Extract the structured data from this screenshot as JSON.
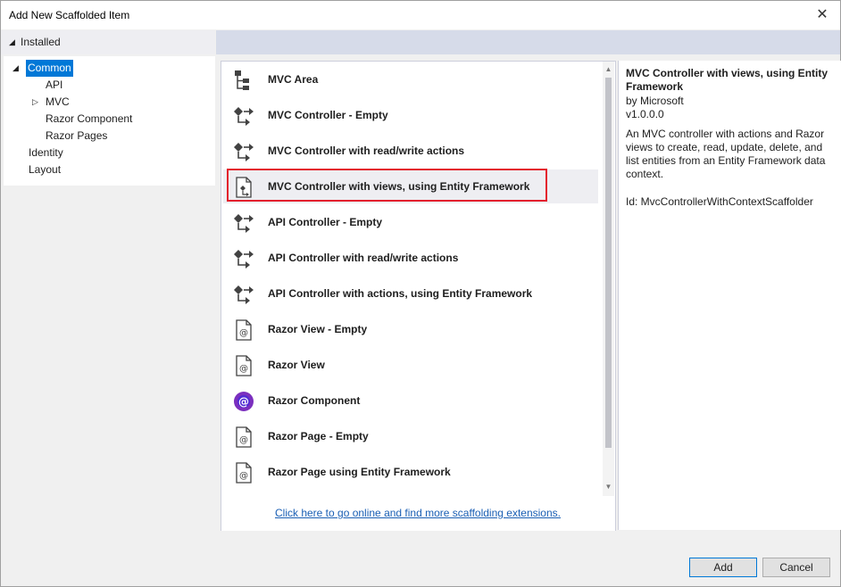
{
  "dialog": {
    "title": "Add New Scaffolded Item",
    "close_glyph": "✕"
  },
  "tree": {
    "header": "Installed",
    "items": [
      {
        "label": "Common",
        "selected": true,
        "expanded": true
      },
      {
        "label": "API"
      },
      {
        "label": "MVC",
        "collapsed": true
      },
      {
        "label": "Razor Component"
      },
      {
        "label": "Razor Pages"
      },
      {
        "label": "Identity"
      },
      {
        "label": "Layout"
      }
    ]
  },
  "templates": [
    {
      "label": "MVC Area",
      "icon": "mvc-area-icon"
    },
    {
      "label": "MVC Controller - Empty",
      "icon": "controller-icon"
    },
    {
      "label": "MVC Controller with read/write actions",
      "icon": "controller-icon"
    },
    {
      "label": "MVC Controller with views, using Entity Framework",
      "icon": "controller-views-icon",
      "selected": true
    },
    {
      "label": "API Controller - Empty",
      "icon": "controller-icon"
    },
    {
      "label": "API Controller with read/write actions",
      "icon": "controller-icon"
    },
    {
      "label": "API Controller with actions, using Entity Framework",
      "icon": "controller-icon"
    },
    {
      "label": "Razor View - Empty",
      "icon": "razor-file-icon"
    },
    {
      "label": "Razor View",
      "icon": "razor-file-icon"
    },
    {
      "label": "Razor Component",
      "icon": "blazor-icon"
    },
    {
      "label": "Razor Page - Empty",
      "icon": "razor-file-icon"
    },
    {
      "label": "Razor Page using Entity Framework",
      "icon": "razor-file-icon"
    }
  ],
  "online_link": "Click here to go online and find more scaffolding extensions.",
  "details": {
    "title": "MVC Controller with views, using Entity Framework",
    "by": "by Microsoft",
    "version": "v1.0.0.0",
    "description": "An MVC controller with actions and Razor views to create, read, update, delete, and list entities from an Entity Framework data context.",
    "id": "Id: MvcControllerWithContextScaffolder"
  },
  "buttons": {
    "add": "Add",
    "cancel": "Cancel"
  },
  "colors": {
    "accent": "#0078d7",
    "highlight_border": "#e3202d",
    "blazor_purple": "#7b2fbe"
  }
}
